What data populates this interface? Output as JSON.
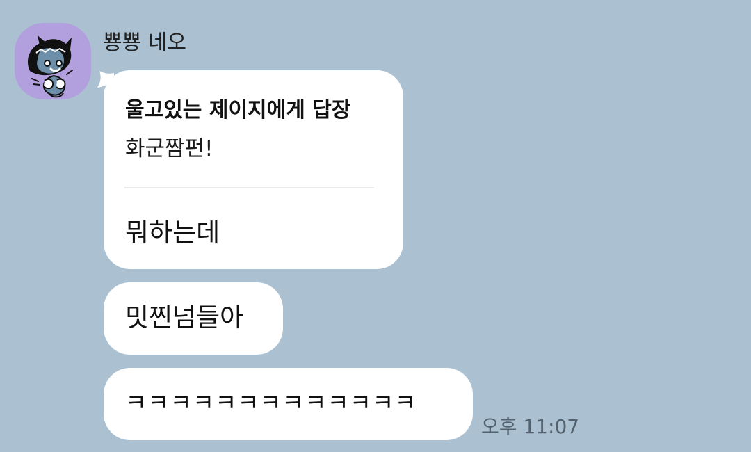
{
  "sender": {
    "name": "뿅뿅 네오",
    "avatar_icon": "neo-character-avatar",
    "avatar_color": "#b19fde"
  },
  "reply": {
    "title": "울고있는 제이지에게 답장",
    "subtitle": "화군짬펀!",
    "message": "뭐하는데"
  },
  "messages": [
    {
      "text": "밋찐넘들아"
    },
    {
      "text": "ㅋㅋㅋㅋㅋㅋㅋㅋㅋㅋㅋㅋㅋ"
    }
  ],
  "timestamp": "오후 11:07",
  "colors": {
    "background": "#abc1d1",
    "bubble": "#ffffff",
    "timestamp": "#52616d"
  }
}
